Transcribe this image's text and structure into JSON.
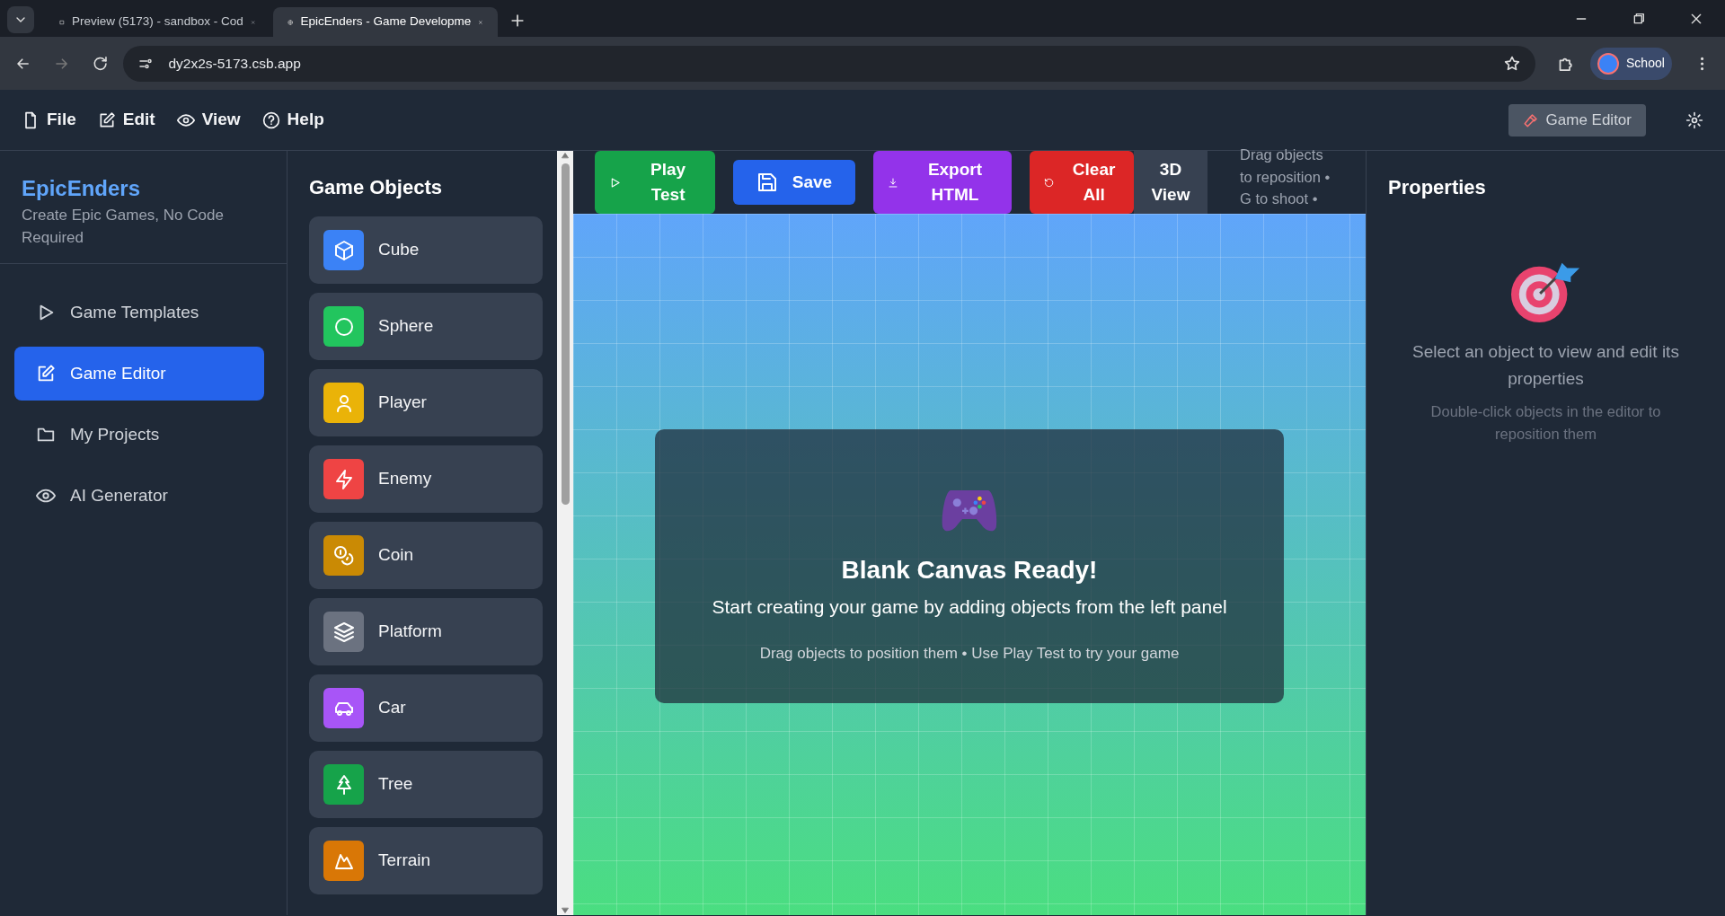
{
  "browser": {
    "tabs": [
      {
        "title": "Preview (5173) - sandbox - Cod",
        "selected": false
      },
      {
        "title": "EpicEnders - Game Developme",
        "selected": true
      }
    ],
    "address": "dy2x2s-5173.csb.app",
    "profile": "School"
  },
  "menu": {
    "items": [
      "File",
      "Edit",
      "View",
      "Help"
    ],
    "mode_button": "Game Editor"
  },
  "sidebar": {
    "brand": "EpicEnders",
    "tagline": "Create Epic Games, No Code Required",
    "items": [
      {
        "label": "Game Templates",
        "selected": false
      },
      {
        "label": "Game Editor",
        "selected": true
      },
      {
        "label": "My Projects",
        "selected": false
      },
      {
        "label": "AI Generator",
        "selected": false
      }
    ]
  },
  "objects": {
    "title": "Game Objects",
    "items": [
      {
        "label": "Cube",
        "color": "#3b82f6"
      },
      {
        "label": "Sphere",
        "color": "#22c55e"
      },
      {
        "label": "Player",
        "color": "#eab308"
      },
      {
        "label": "Enemy",
        "color": "#ef4444"
      },
      {
        "label": "Coin",
        "color": "#ca8a04"
      },
      {
        "label": "Platform",
        "color": "#6b7280"
      },
      {
        "label": "Car",
        "color": "#a855f7"
      },
      {
        "label": "Tree",
        "color": "#16a34a"
      },
      {
        "label": "Terrain",
        "color": "#d97706"
      }
    ]
  },
  "toolbar": {
    "buttons": [
      {
        "label": "Play Test",
        "color": "#16a34a"
      },
      {
        "label": "Save",
        "color": "#2563eb"
      },
      {
        "label": "Export HTML",
        "color": "#9333ea"
      },
      {
        "label": "Clear All",
        "color": "#dc2626"
      },
      {
        "label": "3D View",
        "color": "#374151"
      }
    ],
    "hint_lines": [
      "Drag objects",
      "to reposition •",
      "G to shoot •"
    ]
  },
  "canvas": {
    "title": "Blank Canvas Ready!",
    "subtitle": "Start creating your game by adding objects from the left panel",
    "hint": "Drag objects to position them • Use Play Test to try your game"
  },
  "properties": {
    "title": "Properties",
    "message": "Select an object to view and edit its properties",
    "hint": "Double-click objects in the editor to reposition them"
  }
}
